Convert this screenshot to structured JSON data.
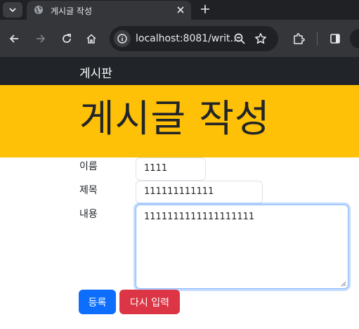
{
  "browser": {
    "tab": {
      "title": "게시글 작성",
      "favicon": "globe-icon"
    },
    "address": {
      "url": "localhost:8081/writ..."
    },
    "icons": [
      "tab-search-icon",
      "close-icon",
      "new-tab-icon",
      "back-icon",
      "forward-icon",
      "reload-icon",
      "home-icon",
      "info-icon",
      "zoom-icon",
      "star-icon",
      "extensions-icon",
      "side-panel-icon"
    ]
  },
  "navbar": {
    "brand": "게시판"
  },
  "hero": {
    "title": "게시글 작성"
  },
  "form": {
    "name_label": "이름",
    "name_value": "1111",
    "title_label": "제목",
    "title_value": "111111111111",
    "content_label": "내용",
    "content_value": "1111111111111111111",
    "submit_label": "등록",
    "reset_label": "다시 입력"
  },
  "colors": {
    "navbar": "#212529",
    "hero": "#ffc107",
    "primary": "#0d6efd",
    "danger": "#dc3545"
  }
}
